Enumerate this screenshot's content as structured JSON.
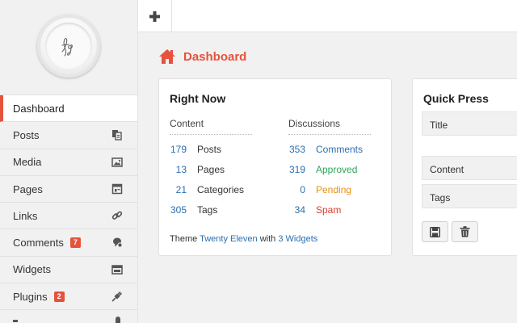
{
  "sidebar": {
    "items": [
      {
        "label": "Dashboard",
        "icon": "",
        "badge": ""
      },
      {
        "label": "Posts",
        "icon": "posts-icon",
        "badge": ""
      },
      {
        "label": "Media",
        "icon": "image-icon",
        "badge": ""
      },
      {
        "label": "Pages",
        "icon": "pages-icon",
        "badge": ""
      },
      {
        "label": "Links",
        "icon": "link-icon",
        "badge": ""
      },
      {
        "label": "Comments",
        "icon": "comments-icon",
        "badge": "7"
      },
      {
        "label": "Widgets",
        "icon": "widgets-icon",
        "badge": ""
      },
      {
        "label": "Plugins",
        "icon": "plugin-icon",
        "badge": "2"
      }
    ]
  },
  "page": {
    "title": "Dashboard"
  },
  "right_now": {
    "title": "Right Now",
    "content_header": "Content",
    "discussions_header": "Discussions",
    "content": [
      {
        "count": "179",
        "label": "Posts"
      },
      {
        "count": "13",
        "label": "Pages"
      },
      {
        "count": "21",
        "label": "Categories"
      },
      {
        "count": "305",
        "label": "Tags"
      }
    ],
    "discussions": [
      {
        "count": "353",
        "label": "Comments",
        "color": "#2a6fb0"
      },
      {
        "count": "319",
        "label": "Approved",
        "color": "#2ea55c"
      },
      {
        "count": "0",
        "label": "Pending",
        "color": "#e8900c"
      },
      {
        "count": "34",
        "label": "Spam",
        "color": "#e03c31"
      }
    ],
    "theme_prefix": "Theme",
    "theme_name": "Twenty Eleven",
    "theme_mid": "with",
    "theme_widgets": "3 Widgets"
  },
  "quick_press": {
    "title": "Quick Press",
    "fields": {
      "title": "Title",
      "content": "Content",
      "tags": "Tags"
    }
  },
  "colors": {
    "accent": "#e5533d",
    "link": "#2a6fb0"
  }
}
